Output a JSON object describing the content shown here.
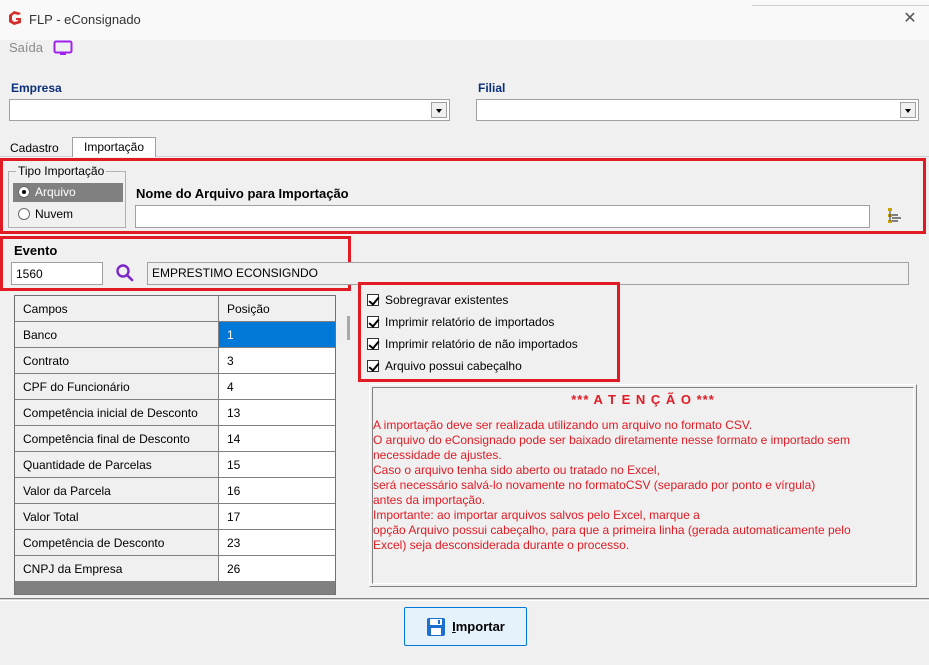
{
  "window": {
    "title": "FLP - eConsignado",
    "close_glyph": "✕",
    "logo_color": "#d32f2f"
  },
  "toolbar": {
    "saida_label": "Saída",
    "monitor_icon_color": "#a020f0"
  },
  "empresa": {
    "label": "Empresa",
    "value": ""
  },
  "filial": {
    "label": "Filial",
    "value": ""
  },
  "tabs": [
    {
      "label": "Cadastro",
      "active": false
    },
    {
      "label": "Importação",
      "active": true
    }
  ],
  "tipo_importacao": {
    "legend": "Tipo Importação",
    "options": [
      {
        "label": "Arquivo",
        "selected": true
      },
      {
        "label": "Nuvem",
        "selected": false
      }
    ]
  },
  "arquivo": {
    "label": "Nome do Arquivo para Importação",
    "value": ""
  },
  "evento": {
    "label": "Evento",
    "code": "1560",
    "description": "EMPRESTIMO ECONSIGNDO"
  },
  "grid": {
    "headers": [
      "Campos",
      "Posição"
    ],
    "rows": [
      {
        "campo": "Banco",
        "posicao": "1"
      },
      {
        "campo": "Contrato",
        "posicao": "3"
      },
      {
        "campo": "CPF do Funcionário",
        "posicao": "4"
      },
      {
        "campo": "Competência inicial de Desconto",
        "posicao": "13"
      },
      {
        "campo": "Competência final de Desconto",
        "posicao": "14"
      },
      {
        "campo": "Quantidade de Parcelas",
        "posicao": "15"
      },
      {
        "campo": "Valor da Parcela",
        "posicao": "16"
      },
      {
        "campo": "Valor Total",
        "posicao": "17"
      },
      {
        "campo": "Competência de Desconto",
        "posicao": "23"
      },
      {
        "campo": "CNPJ da Empresa",
        "posicao": "26"
      }
    ]
  },
  "options": [
    {
      "label": "Sobregravar existentes",
      "checked": true
    },
    {
      "label": "Imprimir relatório de importados",
      "checked": true
    },
    {
      "label": "Imprimir relatório de não importados",
      "checked": true
    },
    {
      "label": "Arquivo possui cabeçalho",
      "checked": true
    }
  ],
  "attention": {
    "title": "*** A T E N Ç Ã O ***",
    "lines": [
      "A importação deve ser realizada utilizando um arquivo no formato CSV.",
      "O arquivo do eConsignado pode ser baixado diretamente nesse formato e importado sem",
      "necessidade de ajustes.",
      "Caso o arquivo tenha sido aberto ou tratado no Excel,",
      "será necessário salvá-lo novamente no formatoCSV (separado por ponto e vírgula)",
      "antes da importação.",
      "Importante: ao importar arquivos salvos pelo Excel, marque a",
      "opção Arquivo possui cabeçalho, para que a primeira linha (gerada automaticamente pelo",
      "Excel) seja desconsiderada durante o processo."
    ],
    "color": "#e01b24"
  },
  "importar_button": {
    "underlined_letter": "I",
    "rest": "mportar"
  },
  "highlight_color": "#e01b24"
}
